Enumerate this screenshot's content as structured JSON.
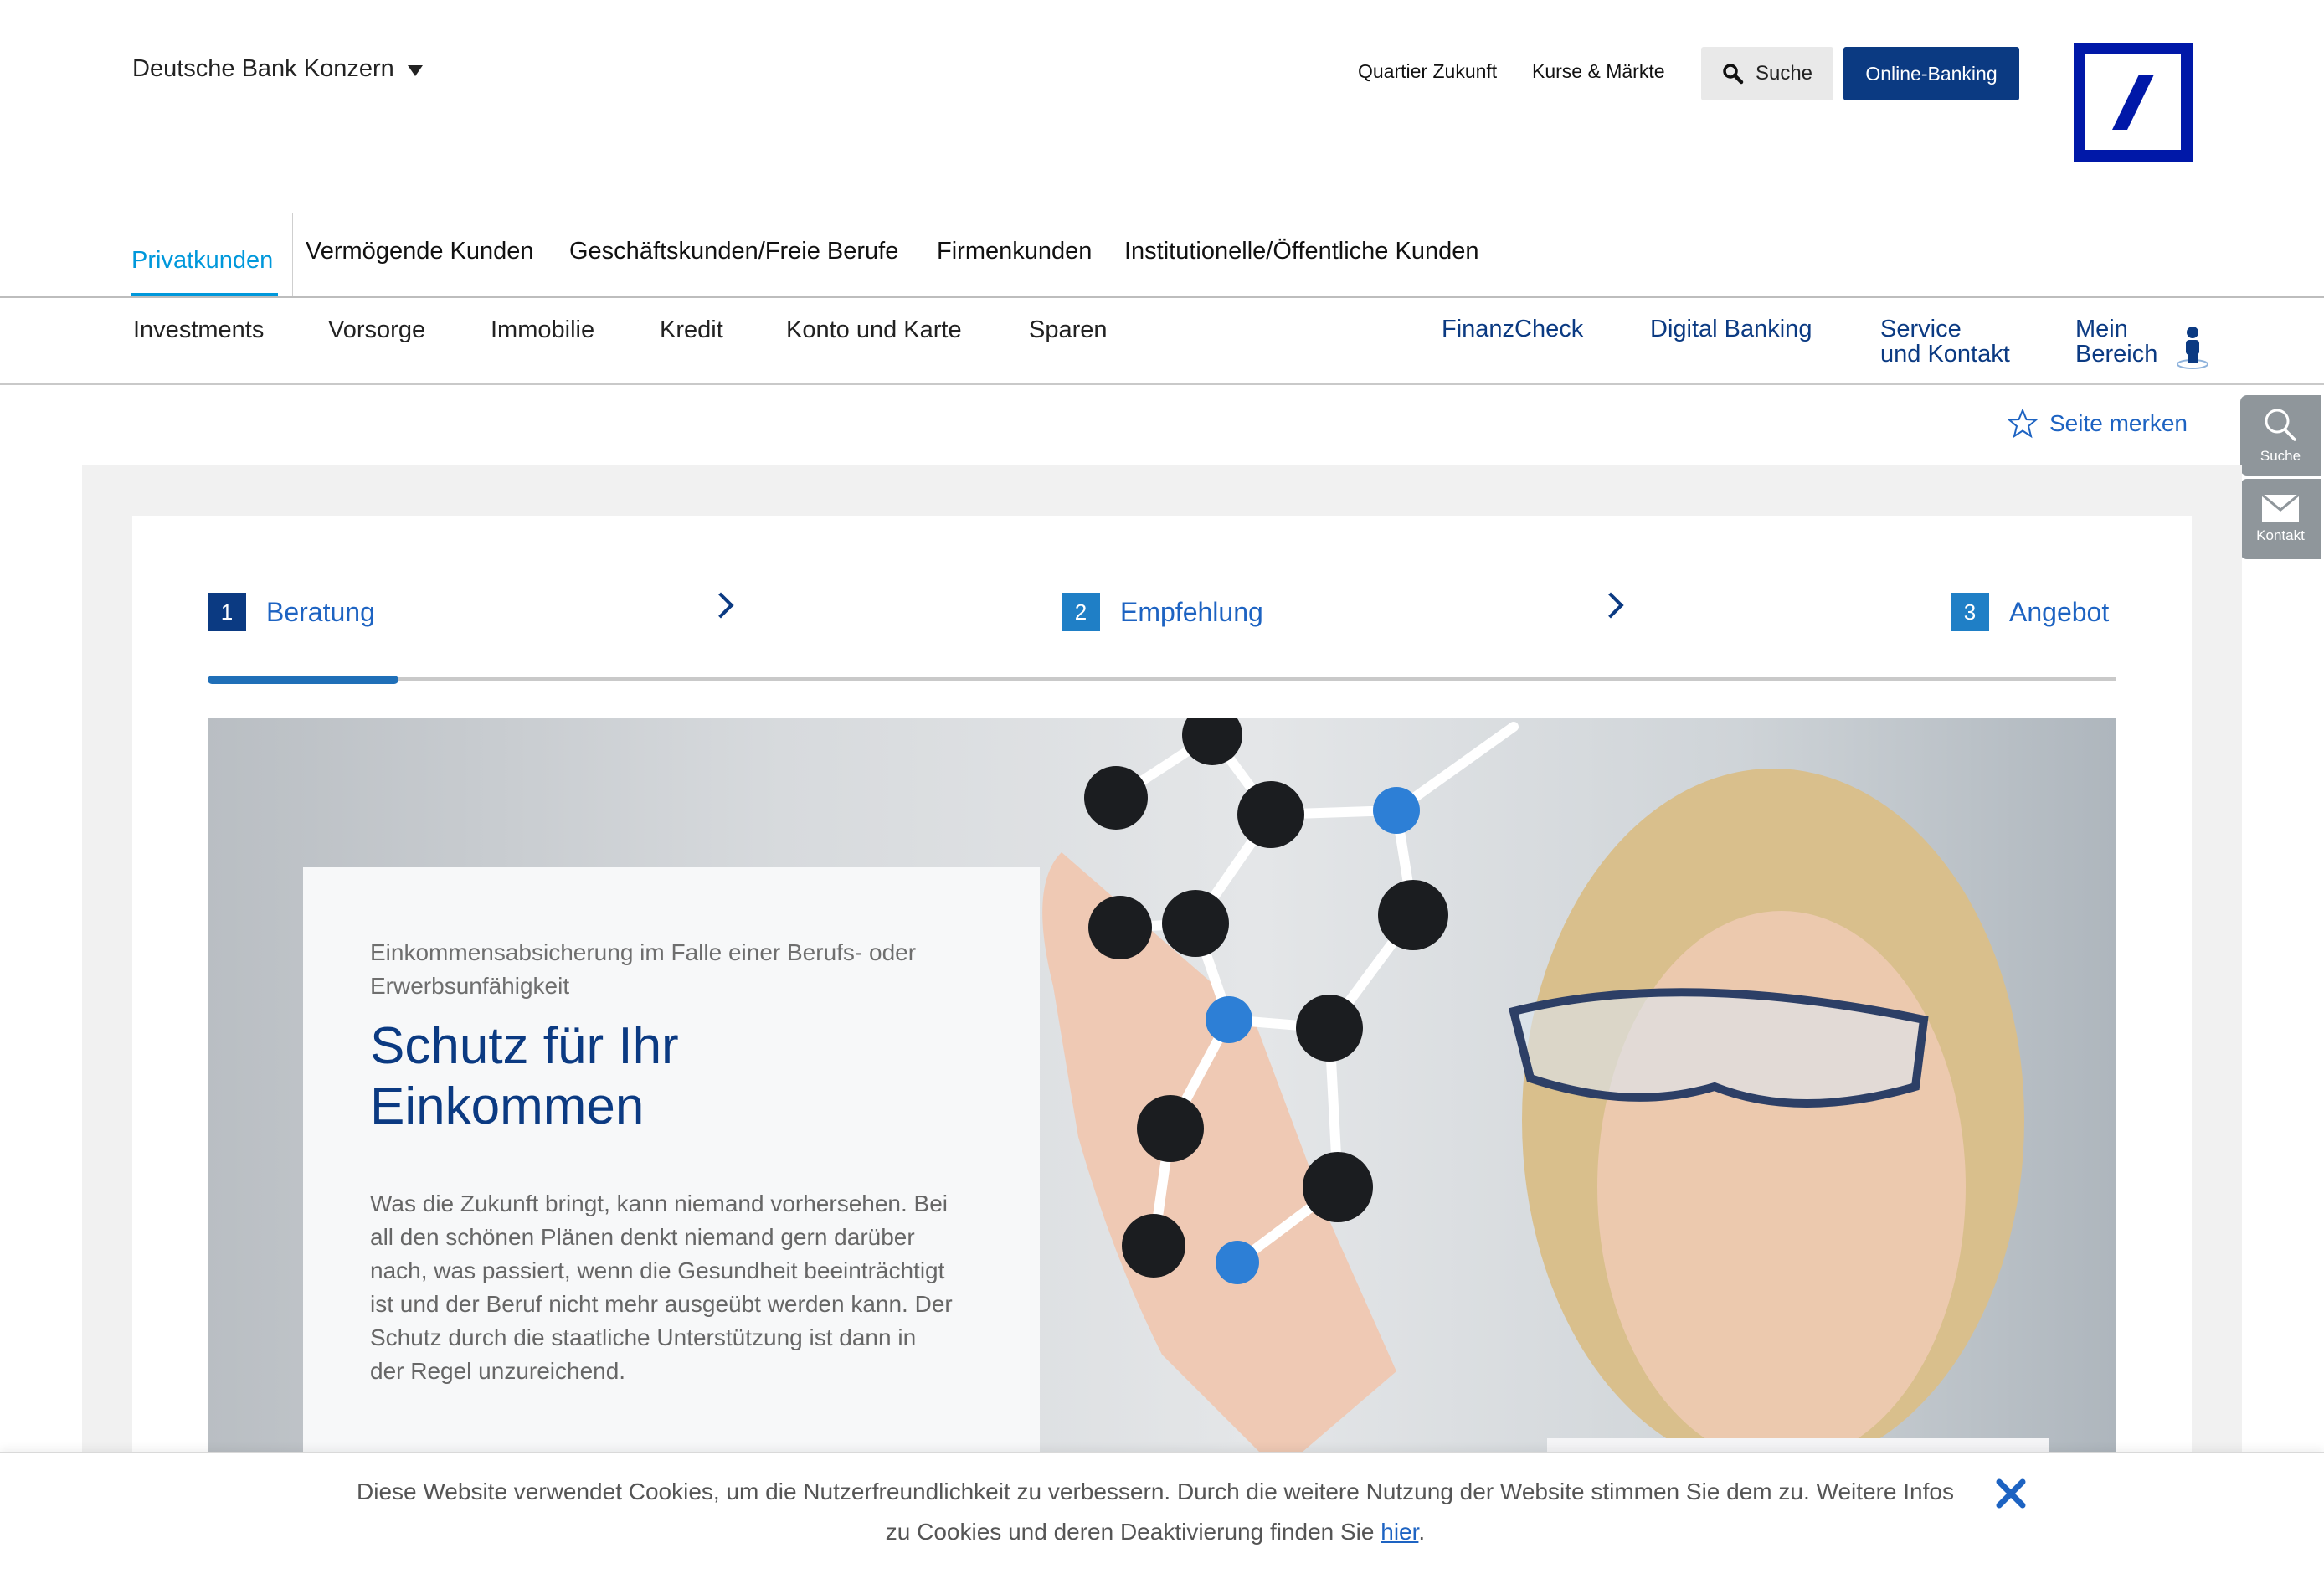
{
  "header": {
    "konzern_label": "Deutsche Bank Konzern",
    "top_links": [
      "Quartier Zukunft",
      "Kurse & Märkte"
    ],
    "search_label": "Suche",
    "online_banking_label": "Online-Banking",
    "brand_color": "#0018a8"
  },
  "segments": {
    "active": "Privatkunden",
    "items": [
      "Vermögende Kunden",
      "Geschäftskunden/Freie Berufe",
      "Firmenkunden",
      "Institutionelle/Öffentliche Kunden"
    ]
  },
  "nav": {
    "left": [
      "Investments",
      "Vorsorge",
      "Immobilie",
      "Kredit",
      "Konto und Karte",
      "Sparen"
    ],
    "right": {
      "finanzcheck": "FinanzCheck",
      "digital_banking": "Digital Banking",
      "service_line1": "Service",
      "service_line2": "und Kontakt",
      "mein_line1": "Mein",
      "mein_line2": "Bereich"
    }
  },
  "side_tabs": {
    "search": "Suche",
    "contact": "Kontakt"
  },
  "bookmark_label": "Seite merken",
  "steps": {
    "items": [
      {
        "num": "1",
        "label": "Beratung"
      },
      {
        "num": "2",
        "label": "Empfehlung"
      },
      {
        "num": "3",
        "label": "Angebot"
      }
    ],
    "active_color": "#0b3a82",
    "inactive_color": "#1f7fc6"
  },
  "hero": {
    "kicker": "Einkommensabsicherung im Falle einer Berufs- oder Erwerbsunfähigkeit",
    "title_line1": "Schutz für Ihr",
    "title_line2": "Einkommen",
    "body": "Was die Zukunft bringt, kann niemand vorhersehen. Bei all den schönen Plänen denkt niemand gern darüber nach, was passiert, wenn die Gesundheit beeinträchtigt ist und der Beruf nicht mehr ausgeübt werden kann. Der Schutz durch die staatliche Unterstützung ist dann in der Regel unzureichend."
  },
  "cookie": {
    "text": "Diese Website verwendet Cookies, um die Nutzerfreundlichkeit zu verbessern. Durch die weitere Nutzung der Website stimmen Sie dem zu. Weitere Infos zu Cookies und deren Deaktivierung finden Sie ",
    "link_label": "hier",
    "suffix": "."
  }
}
